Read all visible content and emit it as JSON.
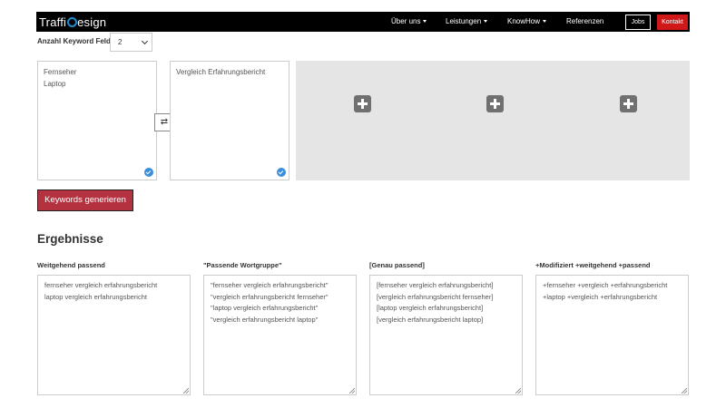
{
  "navbar": {
    "logo_text_a": "Traffi",
    "logo_text_b": "esign",
    "menu": [
      {
        "label": "Über uns"
      },
      {
        "label": "Leistungen"
      },
      {
        "label": "KnowHow"
      },
      {
        "label": "Referenzen"
      }
    ],
    "jobs_label": "Jobs",
    "kontakt_label": "Kontakt",
    "accent_color": "#d01818",
    "logo_accent": "#1a8fd6"
  },
  "keyword_count": {
    "label": "Anzahl Keyword Felder:",
    "selected": "2"
  },
  "keyword_fields": [
    {
      "lines": [
        "Fernseher",
        "Laptop"
      ]
    },
    {
      "lines": [
        "Vergleich Erfahrungsbericht"
      ]
    }
  ],
  "swap_symbol": "⇄",
  "generate_button": "Keywords generieren",
  "results": {
    "title": "Ergebnisse",
    "columns": [
      {
        "label": "Weitgehend passend",
        "lines": [
          "fernseher vergleich erfahrungsbericht",
          "laptop vergleich erfahrungsbericht"
        ]
      },
      {
        "label": "\"Passende Wortgruppe\"",
        "lines": [
          "\"fernseher vergleich erfahrungsbericht\"",
          "\"vergleich erfahrungsbericht fernseher\"",
          "\"laptop vergleich erfahrungsbericht\"",
          "\"vergleich erfahrungsbericht laptop\""
        ]
      },
      {
        "label": "[Genau passend]",
        "lines": [
          "[fernseher vergleich erfahrungsbericht]",
          "[vergleich erfahrungsbericht fernseher]",
          "[laptop vergleich erfahrungsbericht]",
          "[vergleich erfahrungsbericht laptop]"
        ]
      },
      {
        "label": "+Modifiziert +weitgehend +passend",
        "lines": [
          "+fernseher +vergleich +erfahrungsbericht",
          "+laptop +vergleich +erfahrungsbericht"
        ]
      }
    ]
  },
  "colors": {
    "generate_button": "#b4323f",
    "add_area": "#e5e5e5",
    "check": "#3b8fd9"
  }
}
